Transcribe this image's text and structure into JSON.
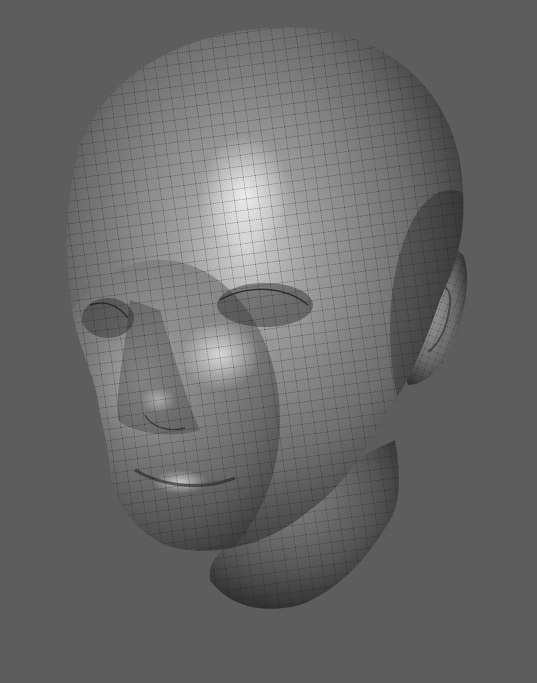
{
  "viewport": {
    "background_color": "#5d5d5d",
    "model": {
      "name": "head",
      "display": "shaded-wireframe",
      "surface_color": "#8a8a8a",
      "highlight_color": "#d8d8d8",
      "shadow_color": "#1e1e1e",
      "wire_color": "#121212"
    }
  }
}
